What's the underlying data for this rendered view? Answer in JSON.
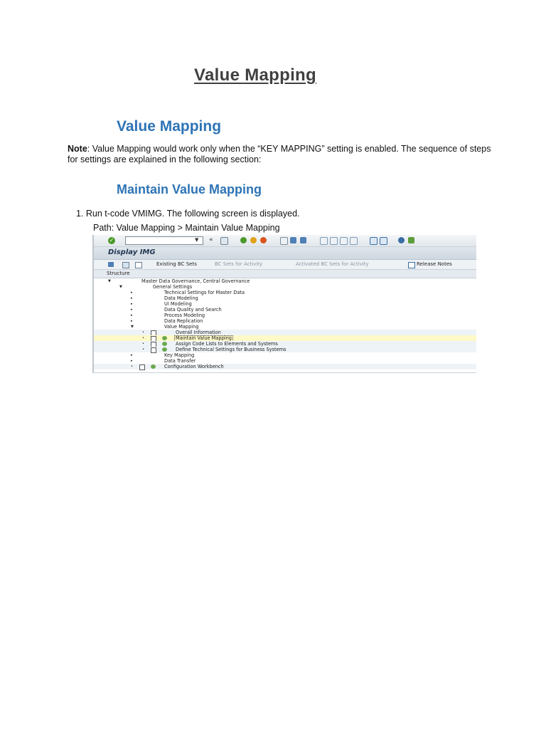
{
  "document": {
    "title": "Value Mapping",
    "heading1": "Value Mapping",
    "note_label": "Note",
    "note_text": ": Value Mapping would work only when the “KEY MAPPING” setting is enabled. The sequence of steps for settings are explained in the following section:",
    "heading2": "Maintain Value Mapping",
    "step1": "1. Run t-code VMIMG. The following screen is displayed.",
    "path": "Path: Value Mapping > Maintain Value Mapping"
  },
  "sap": {
    "window_title": "Display IMG",
    "toolbar": {
      "dropdown_glyph": "▼",
      "nav_glyph": "«",
      "ok_glyph": "✓",
      "icon_colors": [
        "#4c9a2a",
        "#e0a21a",
        "#d9541e",
        "#4f7fb5",
        "#4f7fb5",
        "#7b9bb8",
        "#3a6ea5",
        "#5c9e3a"
      ]
    },
    "app_toolbar": {
      "existing_bc_sets": "Existing BC Sets",
      "bc_sets_for_activity": "BC Sets for Activity",
      "activated_bc_sets": "Activated BC Sets for Activity",
      "release_notes": "Release Notes"
    },
    "structure_header": "Structure",
    "tree": [
      {
        "label": "Master Data Governance, Central Governance",
        "arrow": "▼"
      },
      {
        "label": "General Settings",
        "arrow": "▼"
      },
      {
        "label": "Technical Settings for Master Data",
        "arrow": "▸"
      },
      {
        "label": "Data Modeling",
        "arrow": "▸"
      },
      {
        "label": "UI Modeling",
        "arrow": "▸"
      },
      {
        "label": "Data Quality and Search",
        "arrow": "▸"
      },
      {
        "label": "Process Modeling",
        "arrow": "▸"
      },
      {
        "label": "Data Replication",
        "arrow": "▸"
      },
      {
        "label": "Value Mapping",
        "arrow": "▼"
      },
      {
        "label": "Overall Information",
        "arrow": "•"
      },
      {
        "label": "Maintain Value Mapping",
        "arrow": "•"
      },
      {
        "label": "Assign Code Lists to Elements and Systems",
        "arrow": "•"
      },
      {
        "label": "Define Technical Settings for Business Systems",
        "arrow": "•"
      },
      {
        "label": "Key Mapping",
        "arrow": "▸"
      },
      {
        "label": "Data Transfer",
        "arrow": "▸"
      },
      {
        "label": "Configuration Workbench",
        "arrow": "•"
      }
    ]
  }
}
